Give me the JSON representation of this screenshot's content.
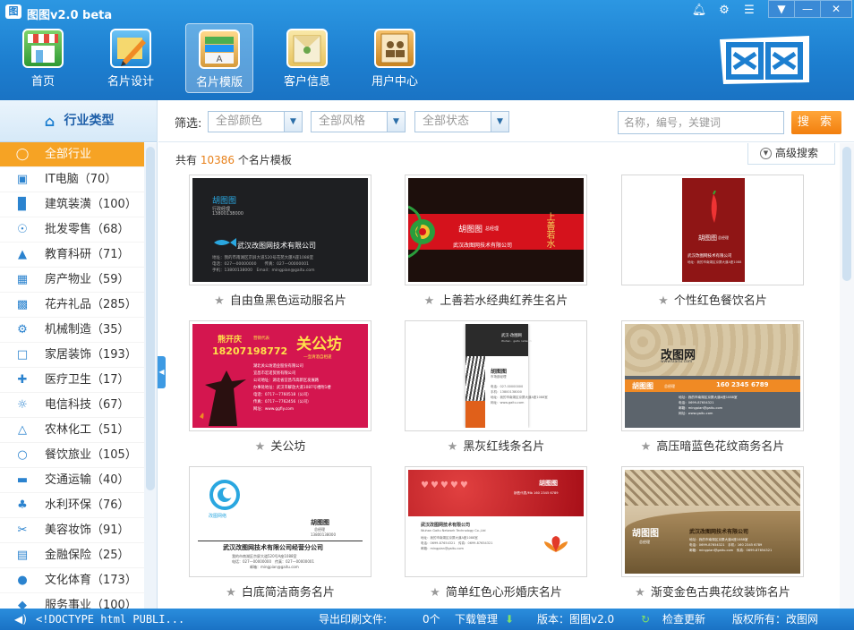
{
  "app": {
    "title": "图图v2.0 beta"
  },
  "window_controls": [
    "bell-icon",
    "gear-icon",
    "chat-icon"
  ],
  "nav": [
    {
      "label": "首页",
      "icon": "home-store-icon"
    },
    {
      "label": "名片设计",
      "icon": "design-pen-icon"
    },
    {
      "label": "名片模版",
      "icon": "template-cards-icon",
      "active": true
    },
    {
      "label": "客户信息",
      "icon": "customer-envelope-icon"
    },
    {
      "label": "用户中心",
      "icon": "user-center-book-icon"
    }
  ],
  "brand_logo_text": "图图",
  "sidebar": {
    "title": "行业类型",
    "items": [
      {
        "label": "全部行业",
        "count": "",
        "icon": "all-circle-icon",
        "active": true
      },
      {
        "label": "IT电脑",
        "count": "（70）",
        "icon": "monitor-icon"
      },
      {
        "label": "建筑装潢",
        "count": "（100）",
        "icon": "paint-roller-icon"
      },
      {
        "label": "批发零售",
        "count": "（68）",
        "icon": "cart-icon"
      },
      {
        "label": "教育科研",
        "count": "（71）",
        "icon": "graduation-cap-icon"
      },
      {
        "label": "房产物业",
        "count": "（59）",
        "icon": "building-icon"
      },
      {
        "label": "花卉礼品",
        "count": "（285）",
        "icon": "gift-icon"
      },
      {
        "label": "机械制造",
        "count": "（35）",
        "icon": "machine-icon"
      },
      {
        "label": "家居装饰",
        "count": "（193）",
        "icon": "chair-icon"
      },
      {
        "label": "医疗卫生",
        "count": "（17）",
        "icon": "medical-kit-icon"
      },
      {
        "label": "电信科技",
        "count": "（67）",
        "icon": "satellite-icon"
      },
      {
        "label": "农林化工",
        "count": "（51）",
        "icon": "flask-icon"
      },
      {
        "label": "餐饮旅业",
        "count": "（105）",
        "icon": "dining-icon"
      },
      {
        "label": "交通运输",
        "count": "（40）",
        "icon": "bus-icon"
      },
      {
        "label": "水利环保",
        "count": "（76）",
        "icon": "tree-icon"
      },
      {
        "label": "美容妆饰",
        "count": "（91）",
        "icon": "scissors-icon"
      },
      {
        "label": "金融保险",
        "count": "（25）",
        "icon": "money-icon"
      },
      {
        "label": "文化体育",
        "count": "（173）",
        "icon": "runner-icon"
      },
      {
        "label": "服务事业",
        "count": "（100）",
        "icon": "service-icon"
      }
    ]
  },
  "filter": {
    "label": "筛选:",
    "color": "全部颜色",
    "style": "全部风格",
    "status": "全部状态",
    "search_placeholder": "名称，编号，关键词",
    "search_button": "搜 索",
    "advanced": "高级搜索"
  },
  "results": {
    "prefix": "共有",
    "count": "10386",
    "suffix": "个名片模板"
  },
  "templates": [
    {
      "name": "自由鱼黑色运动服名片",
      "thumb": {
        "company": "武汉改图网技术有限公司",
        "person": "胡图图",
        "title": "行政经理",
        "phone": "13800138000",
        "addr": "地址：我的市南湖区京屏大道520号花苑大厦A座1088室",
        "contact": "电话：027—00000000　　传真：027—00000001",
        "mobile": "手机：13800138000　Email：mingpian@gaitu.com"
      }
    },
    {
      "name": "上善若水经典红养生名片",
      "thumb": {
        "person": "胡图图",
        "title": "总经理",
        "calligraphy": "上善若水",
        "company": "武汉改图网技术有限公司"
      }
    },
    {
      "name": "个性红色餐饮名片",
      "thumb": {
        "person": "胡图图",
        "title": "总经理",
        "company": "武汉改图网技术有限公司",
        "addr": "地址：我的市南湖区京屏大道A座1088"
      }
    },
    {
      "name": "关公坊",
      "thumb": {
        "person": "熊开庆",
        "title": "营销代表",
        "phone": "18207198772",
        "brand": "关公坊",
        "slogan": "一壶清酒自相逢",
        "company": "湖北关公坊酒业股份有限公司",
        "company2": "宜昌市宏诺贸易有限公司",
        "addr": "公司地址：湖北省宜昌市高新区发展路",
        "office": "办事处地址：武汉市解放大道1087号楼附1楼",
        "tel": "电话：0717—7760518（公司）",
        "tel2": "传真：0717—7762456（公司）",
        "web": "网址：www.ggfiy.com"
      }
    },
    {
      "name": "黑灰红线条名片",
      "thumb": {
        "brand": "武汉·改图网",
        "brand2": "Wuhan · gaitu network",
        "person": "胡图图",
        "title": "市场部经理",
        "phone": "电话：027-00000000",
        "tel": "手机：13800138000",
        "addr": "地址：我的市南湖区京屏大道A座1088室",
        "web": "网址：www.gaitu.com"
      }
    },
    {
      "name": "高压暗蓝色花纹商务名片",
      "thumb": {
        "brand": "改图网",
        "web": "www.Gaitu.com",
        "person": "胡图图",
        "title": "总经理",
        "phone": "160 2345 6789",
        "addr": "地址：我的市南湖区京屏大道A座1088室",
        "tel": "电话：0699-87654321",
        "email": "邮箱：mingpian@gaitu.com",
        "site": "网址：www.gaitu.com"
      }
    },
    {
      "name": "白底简洁商务名片",
      "thumb": {
        "brand": "改图网络",
        "person": "胡图图",
        "title": "总经理",
        "phone": "13800138000",
        "company": "武汉改图网技术有限公司经营分公司",
        "addr": "我的市南湖区京屏大道520号A座1088室",
        "contact": "电话：027—00000000　传真：027—00000001",
        "email": "邮箱：mingpian@gaitu.com"
      }
    },
    {
      "name": "简单红色心形婚庆名片",
      "thumb": {
        "person": "胡图图",
        "title": "销售代表/Mb 160 2345 6789",
        "company": "武汉改图网技术有限公司",
        "company_en": "Wuhan Gaitu Network Technology Co.,Ltd",
        "addr": "地址：我的市南湖区京屏大道A座1088室",
        "tel": "电话：0699-87654321　传真：0699-87654321",
        "email": "邮箱：mingpian@gaitu.com"
      }
    },
    {
      "name": "渐变金色古典花纹装饰名片",
      "thumb": {
        "person": "胡图图",
        "title": "总经理",
        "company": "武汉改图网技术有限公司",
        "addr": "地址：我的市南湖区京屏大道A座1088室",
        "tel": "电话：0699-87654321　手机：160 2345 6789",
        "email": "邮箱：mingpian@gaitu.com　传真：0699-87654321"
      }
    }
  ],
  "statusbar": {
    "doctype": "<!DOCTYPE html PUBLI...",
    "export_label": "导出印刷文件:",
    "export_count": "0个",
    "download": "下载管理",
    "version": "版本：图图v2.0",
    "check_update": "检查更新",
    "copyright": "版权所有：改图网"
  },
  "colors": {
    "accent_orange": "#f6a324",
    "header_blue": "#1d7fd0",
    "count_orange": "#e8811a"
  }
}
